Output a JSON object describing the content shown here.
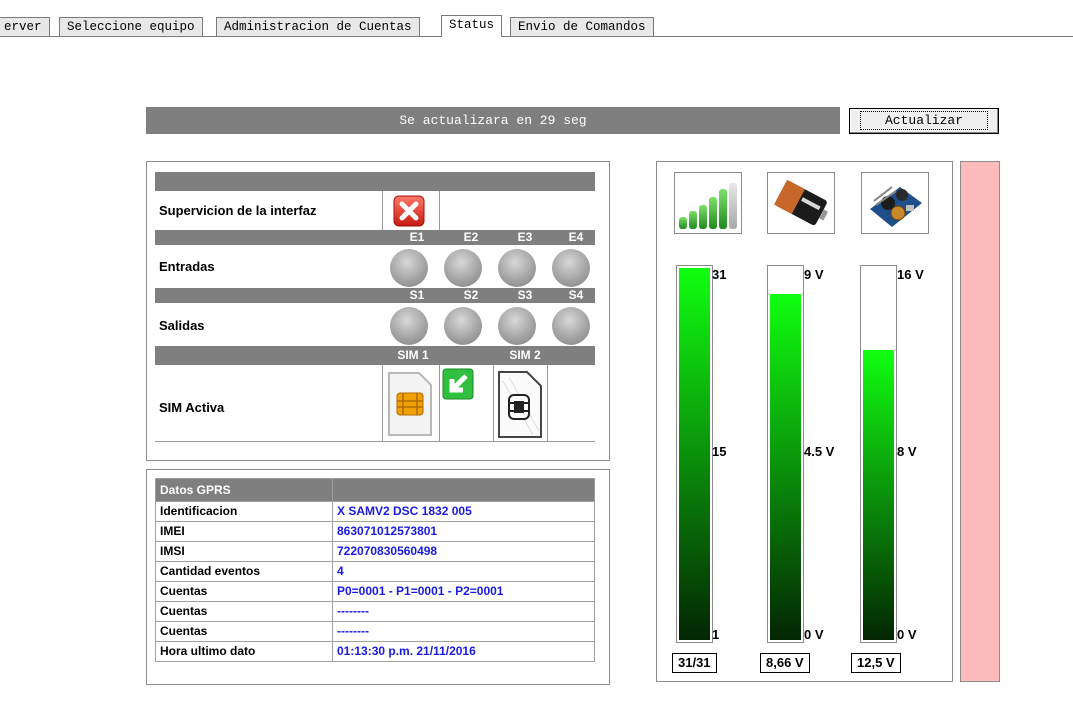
{
  "tabs": [
    {
      "label": "erver"
    },
    {
      "label": "Seleccione equipo"
    },
    {
      "label": "Administracion de Cuentas"
    },
    {
      "label": "Status",
      "active": true
    },
    {
      "label": "Envio de Comandos"
    }
  ],
  "countdown": {
    "text": "Se actualizara en 29 seg"
  },
  "refresh_button": {
    "label": "Actualizar"
  },
  "status": {
    "supervision": {
      "label": "Supervicion de la interfaz",
      "icon": "error-x-icon"
    },
    "inputs": {
      "label": "Entradas",
      "headers": [
        "E1",
        "E2",
        "E3",
        "E4"
      ]
    },
    "outputs": {
      "label": "Salidas",
      "headers": [
        "S1",
        "S2",
        "S3",
        "S4"
      ]
    },
    "sim": {
      "label": "SIM Activa",
      "headers": [
        "SIM 1",
        "SIM 2"
      ],
      "active": "SIM 1"
    }
  },
  "gprs": {
    "title": "Datos GPRS",
    "rows": [
      {
        "key": "Identificacion",
        "value": "X SAMV2 DSC 1832 005"
      },
      {
        "key": "IMEI",
        "value": "863071012573801"
      },
      {
        "key": "IMSI",
        "value": "722070830560498"
      },
      {
        "key": "Cantidad eventos",
        "value": "4"
      },
      {
        "key": "Cuentas",
        "value": "P0=0001 - P1=0001 - P2=0001"
      },
      {
        "key": "Cuentas",
        "value": "--------"
      },
      {
        "key": "Cuentas",
        "value": "--------"
      },
      {
        "key": "Hora ultimo dato",
        "value": "01:13:30 p.m.  21/11/2016"
      }
    ]
  },
  "meters": [
    {
      "icon": "signal-strength-icon",
      "ticks": [
        "31",
        "15",
        "1"
      ],
      "level": 1.0,
      "readout": "31/31"
    },
    {
      "icon": "battery-icon",
      "ticks": [
        "9 V",
        "4.5 V",
        "0 V"
      ],
      "level": 0.93,
      "readout": "8,66 V"
    },
    {
      "icon": "power-supply-icon",
      "ticks": [
        "16 V",
        "8 V",
        "0 V"
      ],
      "level": 0.78,
      "readout": "12,5 V"
    }
  ],
  "colors": {
    "header_gray": "#7f7f7f",
    "value_blue": "#1a1ae0",
    "meter_green": "#10ff10",
    "alarm_pink": "#fcbcbc"
  }
}
